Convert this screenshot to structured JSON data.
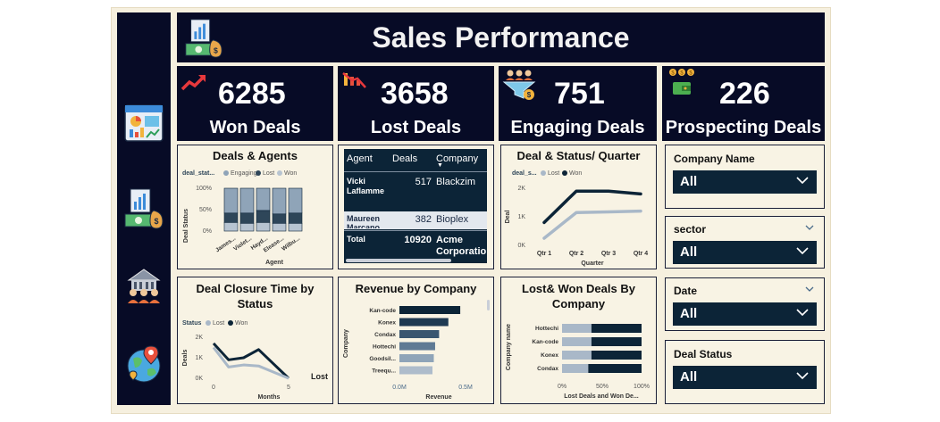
{
  "header": {
    "title": "Sales Performance"
  },
  "sidebar": {
    "icons": [
      "dashboard-icon",
      "sales-money-icon",
      "team-building-icon",
      "globe-map-icon"
    ]
  },
  "kpis": [
    {
      "value": "6285",
      "label": "Won Deals",
      "icon": "trend-up-icon"
    },
    {
      "value": "3658",
      "label": "Lost Deals",
      "icon": "trend-down-icon"
    },
    {
      "value": "751",
      "label": "Engaging Deals",
      "icon": "funnel-people-icon"
    },
    {
      "value": "226",
      "label": "Prospecting Deals",
      "icon": "wallet-coins-icon"
    }
  ],
  "deals_agents": {
    "title": "Deals & Agents",
    "legend_title": "deal_stat...",
    "legend": [
      "Engaging",
      "Lost",
      "Won"
    ],
    "yticks": [
      "100%",
      "50%",
      "0%"
    ],
    "ylabel": "Deal Status",
    "xlabel": "Agent",
    "agents": [
      "James...",
      "Violet...",
      "Hayd...",
      "Elease...",
      "Wilbu..."
    ]
  },
  "table": {
    "columns": [
      "Agent",
      "Deals",
      "Company"
    ],
    "rows": [
      {
        "agent": "Vicki Laflamme",
        "deals": "517",
        "company": "Blackzim"
      },
      {
        "agent": "Maureen Marcano",
        "deals": "382",
        "company": "Bioplex"
      }
    ],
    "total": {
      "label": "Total",
      "deals": "10920",
      "company": "Acme Corporation"
    }
  },
  "status_quarter": {
    "title": "Deal & Status/ Quarter",
    "legend_title": "deal_s...",
    "legend": [
      "Lost",
      "Won"
    ],
    "yticks": [
      "2K",
      "1K",
      "0K"
    ],
    "ylabel": "Deal",
    "xlabel": "Quarter",
    "quarters": [
      "Qtr 1",
      "Qtr 2",
      "Qtr 3",
      "Qtr 4"
    ]
  },
  "closure_time": {
    "title": "Deal Closure Time by Status",
    "legend_title": "Status",
    "legend": [
      "Lost",
      "Won"
    ],
    "yticks": [
      "2K",
      "1K",
      "0K"
    ],
    "ylabel": "Deals",
    "xlabel": "Months",
    "xticks": [
      "0",
      "5"
    ],
    "annotation": "Lost"
  },
  "revenue_company": {
    "title": "Revenue by Company",
    "ylabel": "Company",
    "xlabel": "Revenue",
    "xticks": [
      "0.0M",
      "0.5M"
    ],
    "companies": [
      "Kan-code",
      "Konex",
      "Condax",
      "Hottechi",
      "Goodsil...",
      "Treequ..."
    ]
  },
  "lost_won_company": {
    "title": "Lost& Won Deals By Company",
    "ylabel": "Company name",
    "xlabel": "Lost Deals and Won De...",
    "xticks": [
      "0%",
      "50%",
      "100%"
    ],
    "companies": [
      "Hottechi",
      "Kan-code",
      "Konex",
      "Condax"
    ]
  },
  "slicers": [
    {
      "title": "Company Name",
      "value": "All"
    },
    {
      "title": "sector",
      "value": "All"
    },
    {
      "title": "Date",
      "value": "All"
    },
    {
      "title": "Deal Status",
      "value": "All"
    }
  ],
  "chart_data": [
    {
      "type": "bar",
      "title": "Deals & Agents",
      "stacked": true,
      "categories": [
        "James...",
        "Violet...",
        "Hayd...",
        "Elease...",
        "Wilbu..."
      ],
      "series": [
        {
          "name": "Engaging",
          "values": [
            58,
            58,
            52,
            60,
            58
          ],
          "color": "#8fa4b8"
        },
        {
          "name": "Lost",
          "values": [
            22,
            24,
            28,
            22,
            24
          ],
          "color": "#2e4659"
        },
        {
          "name": "Won",
          "values": [
            20,
            18,
            20,
            18,
            18
          ],
          "color": "#b7c4d1"
        }
      ],
      "ylim": [
        0,
        100
      ],
      "xlabel": "Agent",
      "ylabel": "Deal Status"
    },
    {
      "type": "line",
      "title": "Deal & Status/ Quarter",
      "categories": [
        "Qtr 1",
        "Qtr 2",
        "Qtr 3",
        "Qtr 4"
      ],
      "series": [
        {
          "name": "Lost",
          "values": [
            250,
            1150,
            1170,
            1200
          ],
          "color": "#a9b8c8"
        },
        {
          "name": "Won",
          "values": [
            800,
            1900,
            1900,
            1800
          ],
          "color": "#0c2437"
        }
      ],
      "ylim": [
        0,
        2000
      ],
      "xlabel": "Quarter",
      "ylabel": "Deal"
    },
    {
      "type": "line",
      "title": "Deal Closure Time by Status",
      "x": [
        0,
        1,
        2,
        3,
        4,
        5
      ],
      "series": [
        {
          "name": "Lost",
          "values": [
            1700,
            900,
            1000,
            1400,
            700,
            0
          ],
          "color": "#0c2437"
        },
        {
          "name": "Won",
          "values": [
            1500,
            550,
            650,
            600,
            300,
            0
          ],
          "color": "#a9b8c8"
        }
      ],
      "ylim": [
        0,
        2000
      ],
      "xlabel": "Months",
      "ylabel": "Deals"
    },
    {
      "type": "bar",
      "orientation": "horizontal",
      "title": "Revenue by Company",
      "categories": [
        "Kan-code",
        "Konex",
        "Condax",
        "Hottechi",
        "Goodsil...",
        "Treequ..."
      ],
      "values": [
        0.46,
        0.37,
        0.3,
        0.27,
        0.26,
        0.25
      ],
      "xlim": [
        0,
        0.6
      ],
      "xlabel": "Revenue",
      "ylabel": "Company"
    },
    {
      "type": "bar",
      "orientation": "horizontal",
      "stacked": true,
      "title": "Lost& Won Deals By Company",
      "categories": [
        "Hottechi",
        "Kan-code",
        "Konex",
        "Condax"
      ],
      "series": [
        {
          "name": "Lost",
          "values": [
            37,
            37,
            37,
            33
          ],
          "color": "#a9b8c8"
        },
        {
          "name": "Won",
          "values": [
            63,
            63,
            63,
            67
          ],
          "color": "#0c2437"
        }
      ],
      "xlim": [
        0,
        100
      ],
      "xlabel": "Lost Deals and Won De...",
      "ylabel": "Company name"
    }
  ]
}
